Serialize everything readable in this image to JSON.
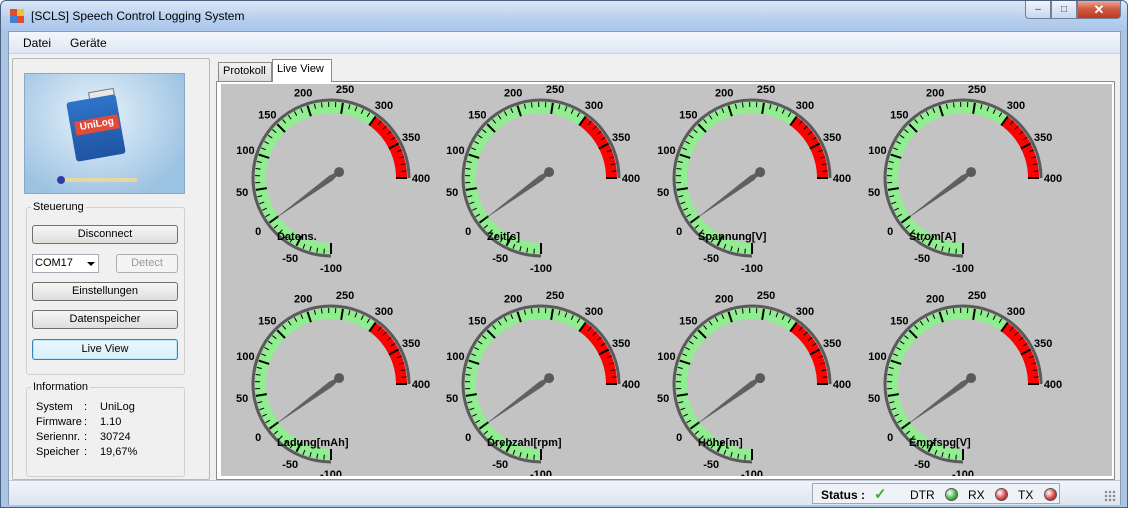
{
  "window": {
    "title": "[SCLS] Speech Control Logging System",
    "controls": {
      "minimize": "‒",
      "maximize": "□",
      "close": "✕"
    }
  },
  "menu": [
    "Datei",
    "Geräte"
  ],
  "logo": {
    "label": "UniLog"
  },
  "steuerung": {
    "legend": "Steuerung",
    "disconnect": "Disconnect",
    "port": "COM17",
    "detect": "Detect",
    "einstellungen": "Einstellungen",
    "datenspeicher": "Datenspeicher",
    "liveview": "Live View"
  },
  "information": {
    "legend": "Information",
    "rows": [
      {
        "key": "System",
        "sep": ":",
        "value": "UniLog"
      },
      {
        "key": "Firmware",
        "sep": ":",
        "value": "1.10"
      },
      {
        "key": "Seriennr.",
        "sep": ":",
        "value": "30724"
      },
      {
        "key": "Speicher",
        "sep": ":",
        "value": "19,67%"
      }
    ]
  },
  "tabs": [
    "Protokoll",
    "Live View"
  ],
  "active_tab": "Live View",
  "gauges": {
    "scale": {
      "min": -100,
      "max": 400,
      "ticks": [
        "-100",
        "-50",
        "0",
        "50",
        "100",
        "150",
        "200",
        "250",
        "300",
        "350",
        "400"
      ]
    },
    "colors": {
      "green": "#90ee90",
      "red": "#ff0000",
      "needle": "#606060",
      "face": "#c3c3c3"
    },
    "needle_value": 0,
    "green_range": [
      -100,
      300
    ],
    "red_range": [
      300,
      400
    ],
    "items": [
      {
        "label": "Datens."
      },
      {
        "label": "Zeit[s]"
      },
      {
        "label": "Spannung[V]"
      },
      {
        "label": "Strom[A]"
      },
      {
        "label": "Ladung[mAh]"
      },
      {
        "label": "Drehzahl[rpm]"
      },
      {
        "label": "Höhe[m]"
      },
      {
        "label": "Empfspg[V]"
      }
    ]
  },
  "status": {
    "label": "Status :",
    "ok_icon": "checkmark-icon",
    "dtr": "DTR",
    "rx": "RX",
    "tx": "TX",
    "dtr_color": "#3cb043",
    "rx_color": "#d93a3a",
    "tx_color": "#d93a3a"
  }
}
